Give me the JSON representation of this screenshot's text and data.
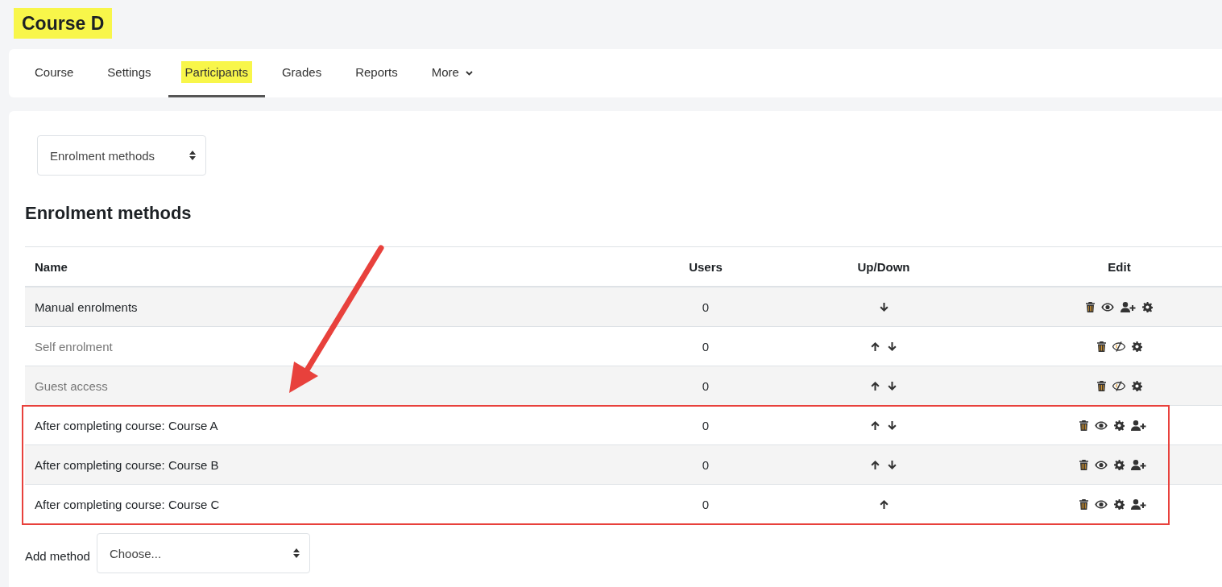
{
  "page_title": {
    "text": "Course D",
    "highlighted": true
  },
  "tabs": [
    {
      "label": "Course",
      "selected": false,
      "highlighted": false
    },
    {
      "label": "Settings",
      "selected": false,
      "highlighted": false
    },
    {
      "label": "Participants",
      "selected": true,
      "highlighted": true
    },
    {
      "label": "Grades",
      "selected": false,
      "highlighted": false
    },
    {
      "label": "Reports",
      "selected": false,
      "highlighted": false
    },
    {
      "label": "More",
      "selected": false,
      "highlighted": false,
      "kind": "dropdown"
    }
  ],
  "page_select": {
    "value": "Enrolment methods"
  },
  "heading": "Enrolment methods",
  "table": {
    "columns": [
      "Name",
      "Users",
      "Up/Down",
      "Edit"
    ],
    "rows": [
      {
        "name": "Manual enrolments",
        "users": "0",
        "enabled": true,
        "moves": [
          {
            "kind": "down"
          }
        ],
        "actions": [
          {
            "kind": "delete"
          },
          {
            "kind": "visibility"
          },
          {
            "kind": "enrol_users"
          },
          {
            "kind": "settings"
          }
        ],
        "boxed": false
      },
      {
        "name": "Self enrolment",
        "users": "0",
        "enabled": false,
        "moves": [
          {
            "kind": "up"
          },
          {
            "kind": "down"
          }
        ],
        "actions": [
          {
            "kind": "delete"
          },
          {
            "kind": "visibility"
          },
          {
            "kind": "settings"
          }
        ],
        "boxed": false
      },
      {
        "name": "Guest access",
        "users": "0",
        "enabled": false,
        "moves": [
          {
            "kind": "up"
          },
          {
            "kind": "down"
          }
        ],
        "actions": [
          {
            "kind": "delete"
          },
          {
            "kind": "visibility"
          },
          {
            "kind": "settings"
          }
        ],
        "boxed": false
      },
      {
        "name": "After completing course: Course A",
        "users": "0",
        "enabled": true,
        "moves": [
          {
            "kind": "up"
          },
          {
            "kind": "down"
          }
        ],
        "actions": [
          {
            "kind": "delete"
          },
          {
            "kind": "visibility"
          },
          {
            "kind": "settings"
          },
          {
            "kind": "enrol_users"
          }
        ],
        "boxed": true
      },
      {
        "name": "After completing course: Course B",
        "users": "0",
        "enabled": true,
        "moves": [
          {
            "kind": "up"
          },
          {
            "kind": "down"
          }
        ],
        "actions": [
          {
            "kind": "delete"
          },
          {
            "kind": "visibility"
          },
          {
            "kind": "settings"
          },
          {
            "kind": "enrol_users"
          }
        ],
        "boxed": true
      },
      {
        "name": "After completing course: Course C",
        "users": "0",
        "enabled": true,
        "moves": [
          {
            "kind": "up"
          }
        ],
        "actions": [
          {
            "kind": "delete"
          },
          {
            "kind": "visibility"
          },
          {
            "kind": "settings"
          },
          {
            "kind": "enrol_users"
          }
        ],
        "boxed": true
      }
    ]
  },
  "add_method": {
    "label": "Add method",
    "select": {
      "value": "Choose..."
    }
  }
}
